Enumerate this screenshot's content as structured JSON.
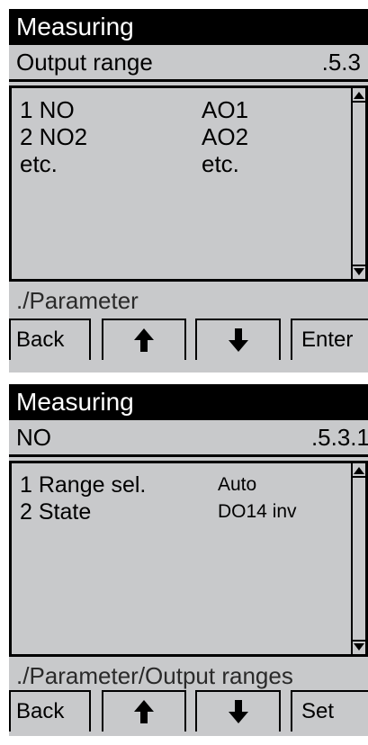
{
  "screens": [
    {
      "title": "Measuring",
      "header": {
        "name": "Output range",
        "code": ".5.3"
      },
      "rows": [
        {
          "label": "1 NO",
          "value": "AO1"
        },
        {
          "label": "2 NO2",
          "value": "AO2"
        },
        {
          "label": "etc.",
          "value": "etc."
        }
      ],
      "path": "./Parameter",
      "buttons": {
        "back": "Back",
        "up_icon": "arrow-up-icon",
        "down_icon": "arrow-down-icon",
        "action": "Enter"
      }
    },
    {
      "title": "Measuring",
      "header": {
        "name": "NO",
        "code": ".5.3.1"
      },
      "rows": [
        {
          "label": "1 Range sel.",
          "value": "Auto"
        },
        {
          "label": "2 State",
          "value": "DO14 inv"
        }
      ],
      "path": "./Parameter/Output ranges",
      "buttons": {
        "back": "Back",
        "up_icon": "arrow-up-icon",
        "down_icon": "arrow-down-icon",
        "action": "Set"
      }
    }
  ],
  "colors": {
    "screen_background": "#c8c9cb",
    "title_background": "#000000",
    "title_text": "#ffffff"
  }
}
